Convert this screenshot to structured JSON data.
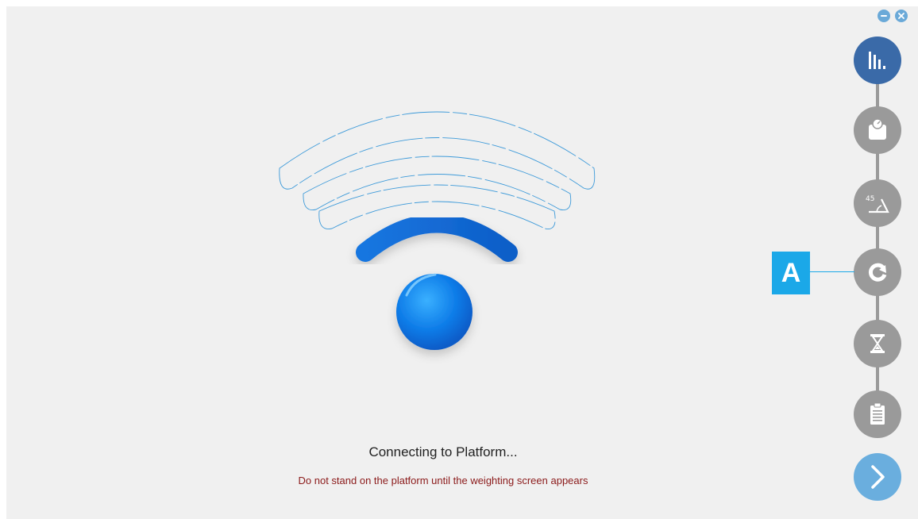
{
  "window": {
    "minimize_icon": "minimize-icon",
    "close_icon": "close-icon",
    "accent_color": "#6aa9d8"
  },
  "main": {
    "illustration_icon": "wifi-connecting-icon",
    "status_title": "Connecting to Platform...",
    "status_warning": "Do not stand on the platform until the weighting screen appears",
    "warning_color": "#8b1a1a"
  },
  "stepper": {
    "steps": [
      {
        "icon": "bar-chart-icon",
        "state": "active"
      },
      {
        "icon": "weighing-scale-icon",
        "state": "inactive"
      },
      {
        "icon": "angle-45-icon",
        "state": "inactive"
      },
      {
        "icon": "rotate-icon",
        "state": "inactive"
      },
      {
        "icon": "hourglass-icon",
        "state": "inactive"
      },
      {
        "icon": "clipboard-icon",
        "state": "inactive"
      }
    ],
    "next_icon": "chevron-right-icon",
    "marker_label": "A",
    "marker_color": "#1ba8e8",
    "active_color": "#3a6aa8",
    "inactive_color": "#9a9a9a"
  }
}
